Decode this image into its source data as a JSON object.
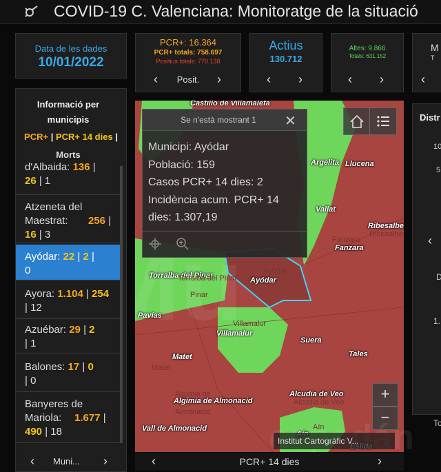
{
  "app": {
    "title": "COVID-19 C. Valenciana: Monitoratge de la situació",
    "logo_icon": "virus-icon"
  },
  "date_card": {
    "label": "Data de les dades",
    "value": "10/01/2022"
  },
  "pcr_card": {
    "line1": "PCR+: 16.364",
    "line2": "PCR+ totals: 758.697",
    "line3": "Positius totals: 770.138",
    "nav_label": "Posit."
  },
  "actius_card": {
    "label": "Actius",
    "value": "130.712"
  },
  "altes_card": {
    "line1": "Altes: 9.866",
    "line2": "Totals: 631.152"
  },
  "partial_card": {
    "label": "M",
    "line2": "T"
  },
  "sidebar": {
    "title": "Informació per municipis",
    "legend_pcr": "PCR+",
    "legend_sep1": " | ",
    "legend_pcr14": "PCR+ 14 dies",
    "legend_sep2": " |",
    "legend_morts": "Morts",
    "items": [
      {
        "name": "d'Albaida:",
        "pcr": "136",
        "pcr14": "26",
        "morts": "1"
      },
      {
        "name": "Atzeneta del Maestrat:",
        "pcr": "256",
        "pcr14": "16",
        "morts": "3"
      },
      {
        "name": "Ayódar:",
        "pcr": "22",
        "pcr14": "2",
        "morts": "0"
      },
      {
        "name": "Ayora:",
        "pcr": "1.104",
        "pcr14": "254",
        "morts": "12"
      },
      {
        "name": "Azuébar:",
        "pcr": "29",
        "pcr14": "2",
        "morts": "1"
      },
      {
        "name": "Balones:",
        "pcr": "17",
        "pcr14": "0",
        "morts": "0"
      },
      {
        "name": "Banyeres de Mariola:",
        "pcr": "1.677",
        "pcr14": "490",
        "morts": "18"
      }
    ],
    "footer_label": "Muni..."
  },
  "popup": {
    "header": "Se n'està mostrant 1",
    "municipi": "Municipi: Ayódar",
    "poblacio": "Població: 159",
    "casos": "Casos PCR+ 14 dies: 2",
    "incidencia": "Incidència acum. PCR+ 14 dies: 1.307,19"
  },
  "map": {
    "labels": {
      "castillo": "Castillo de Villamalefa",
      "argelita": "Argelita",
      "llucena": "Llucena",
      "vallat": "Vallat",
      "ribesalbes": "Ribesalbes",
      "fanzara": "Fanzara",
      "fanzara_d": "Fanzara",
      "ribesalbes_d": "Ribesalbes",
      "torralba": "Torralba del Pinar",
      "torralba_d": "Torralba del Pinar",
      "ayodar": "Ayódar",
      "ayodar_d": "Ayódar",
      "pinar_d": "Pinar",
      "pavias": "Pavías",
      "villamalur": "Villamalur",
      "villamalur_d": "Villamalur",
      "suera": "Suera",
      "tales": "Tales",
      "matet": "Matet",
      "matet_d": "Matet",
      "algimia": "Algímia de Almonacid",
      "algimia_d": "Algímia de",
      "almonacid_d": "Almonacid",
      "alcudia": "Alcudia de Veo",
      "alcudia_d": "Alcudia de Veo",
      "vall": "Vall de Almonacid",
      "ain": "Aín",
      "ain_d": "Aín",
      "eslida": "Eslida"
    },
    "attribution": "Institut Cartogràfic V...",
    "footer_label": "PCR+ 14 dies",
    "zoom_in": "+",
    "zoom_out": "−"
  },
  "right_panel": {
    "title": "Distr",
    "tick1": "10",
    "tick2": "5",
    "tick3": "D",
    "tick4": "1.",
    "tick5": "To"
  },
  "watermark": {
    "text1": "Mu",
    "text2": "espadán"
  },
  "colors": {
    "accent_blue": "#39a8e8",
    "orange": "#f5a623",
    "red": "#e8412c",
    "green": "#5cd65c",
    "map_red": "#a84540",
    "map_green": "#6fd65c",
    "selection_blue": "#2b80d0"
  }
}
